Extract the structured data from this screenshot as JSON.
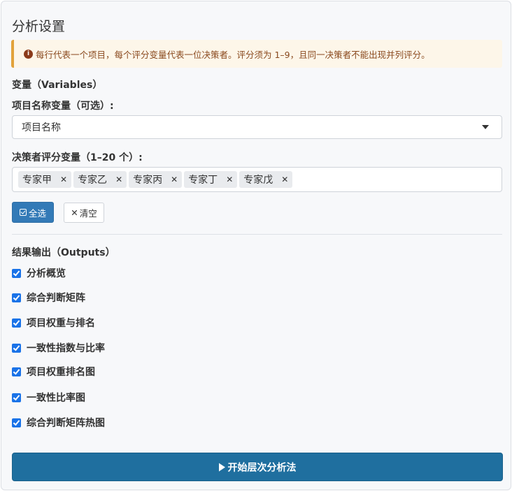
{
  "panel": {
    "title": "分析设置",
    "notice": "每行代表一个项目，每个评分变量代表一位决策者。评分须为 1–9，且同一决策者不能出现并列评分。"
  },
  "variables": {
    "section_label": "变量（Variables）",
    "item_name": {
      "label": "项目名称变量（可选）:",
      "selected": "项目名称"
    },
    "raters": {
      "label": "决策者评分变量（1–20 个）:",
      "selected": [
        "专家甲",
        "专家乙",
        "专家丙",
        "专家丁",
        "专家戊"
      ]
    },
    "select_all_label": "全选",
    "clear_label": "清空"
  },
  "outputs": {
    "section_label": "结果输出（Outputs）",
    "items": [
      {
        "label": "分析概览",
        "checked": true
      },
      {
        "label": "综合判断矩阵",
        "checked": true
      },
      {
        "label": "项目权重与排名",
        "checked": true
      },
      {
        "label": "一致性指数与比率",
        "checked": true
      },
      {
        "label": "项目权重排名图",
        "checked": true
      },
      {
        "label": "一致性比率图",
        "checked": true
      },
      {
        "label": "综合判断矩阵热图",
        "checked": true
      }
    ]
  },
  "run_label": "开始层次分析法",
  "colors": {
    "primary": "#337ab7",
    "run_button": "#1f6f9f",
    "checkbox": "#1a73e8",
    "notice_border": "#e2a23a",
    "notice_text": "#8a4a1f"
  }
}
